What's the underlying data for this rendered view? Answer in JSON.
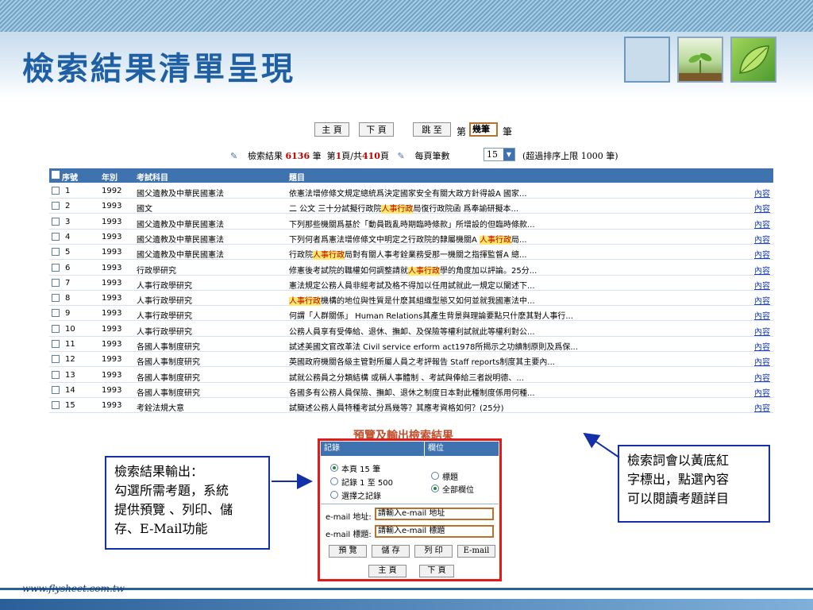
{
  "slide": {
    "title": "檢索結果清單呈現",
    "footer_url": "www.flysheet.com.tw"
  },
  "nav": {
    "home": "主 頁",
    "next": "下 頁",
    "jump": "跳 至",
    "page_prefix": "第",
    "page_value": "幾筆",
    "page_suffix": "筆"
  },
  "result_info": {
    "label": "檢索結果",
    "count": "6136",
    "count_unit": "筆",
    "page_text_prefix": "第",
    "page_current": "1",
    "page_text_mid": "頁/共",
    "page_total": "410",
    "page_text_suffix": "頁",
    "per_page_label": "每頁筆數",
    "per_page_value": "15",
    "limit_note": "(超過排序上限 1000 筆)"
  },
  "table": {
    "columns": [
      "序號",
      "年別",
      "考試科目",
      "題目"
    ],
    "rows": [
      {
        "no": "1",
        "year": "1992",
        "subject": "國父遺教及中華民國憲法",
        "pre": "依憲法增修條文規定總統爲決定國家安全有關大政方針得設A 國家...",
        "hl": "",
        "post": "",
        "link": "內容"
      },
      {
        "no": "2",
        "year": "1993",
        "subject": "國文",
        "pre": "二 公文 三十分試擬行政院",
        "hl": "人事行政",
        "post": "局復行政院函 爲奉諭研擬本...",
        "link": "內容"
      },
      {
        "no": "3",
        "year": "1993",
        "subject": "國父遺教及中華民國憲法",
        "pre": "下列那些機關爲基於「動員戡亂時期臨時條款」所增設的但臨時條款...",
        "hl": "",
        "post": "",
        "link": "內容"
      },
      {
        "no": "4",
        "year": "1993",
        "subject": "國父遺教及中華民國憲法",
        "pre": "下列何者爲憲法增修條文中明定之行政院的隸屬機關A ",
        "hl": "人事行政",
        "post": "局...",
        "link": "內容"
      },
      {
        "no": "5",
        "year": "1993",
        "subject": "國父遺教及中華民國憲法",
        "pre": "行政院",
        "hl": "人事行政",
        "post": "局對有關人事考銓業務受那一機關之指揮監督A 總...",
        "link": "內容"
      },
      {
        "no": "6",
        "year": "1993",
        "subject": "行政學研究",
        "pre": "修憲後考試院的職權如何調整請就",
        "hl": "人事行政",
        "post": "學的角度加以評論。25分...",
        "link": "內容"
      },
      {
        "no": "7",
        "year": "1993",
        "subject": "人事行政學研究",
        "pre": "憲法規定公務人員非經考試及格不得加以任用試就此一規定以闡述下...",
        "hl": "",
        "post": "",
        "link": "內容"
      },
      {
        "no": "8",
        "year": "1993",
        "subject": "人事行政學研究",
        "pre": "",
        "hl": "人事行政",
        "post": "機構的地位與性質是什麽其組織型態又如何並就我國憲法中...",
        "link": "內容"
      },
      {
        "no": "9",
        "year": "1993",
        "subject": "人事行政學研究",
        "pre": "何謂「人群關係」 Human Relations其產生背景與理論要點只什麽其對人事行...",
        "hl": "",
        "post": "",
        "link": "內容"
      },
      {
        "no": "10",
        "year": "1993",
        "subject": "人事行政學研究",
        "pre": "公務人員享有受俸給、退休、撫卹、及保險等權利試就此等權利對公...",
        "hl": "",
        "post": "",
        "link": "內容"
      },
      {
        "no": "11",
        "year": "1993",
        "subject": "各國人事制度研究",
        "pre": "試述美國文官改革法 Civil service erform act1978所揭示之功績制原則及爲保...",
        "hl": "",
        "post": "",
        "link": "內容"
      },
      {
        "no": "12",
        "year": "1993",
        "subject": "各國人事制度研究",
        "pre": "英國政府機關各級主管對所屬人員之考評報告 Staff reports制度其主要內...",
        "hl": "",
        "post": "",
        "link": "內容"
      },
      {
        "no": "13",
        "year": "1993",
        "subject": "各國人事制度研究",
        "pre": "試就公務員之分類結構 或稱人事體制 、考試與俸給三者說明德、...",
        "hl": "",
        "post": "",
        "link": "內容"
      },
      {
        "no": "14",
        "year": "1993",
        "subject": "各國人事制度研究",
        "pre": "各國多有公務人員保險、撫卹、退休之制度日本對此種制度係用何種...",
        "hl": "",
        "post": "",
        "link": "內容"
      },
      {
        "no": "15",
        "year": "1993",
        "subject": "考銓法規大意",
        "pre": "試簡述公務人員特種考試分爲幾等？其應考資格如何？(25分)",
        "hl": "",
        "post": "",
        "link": "內容"
      }
    ]
  },
  "output_panel": {
    "title": "預覽及輸出檢索結果",
    "col_records": "記錄",
    "col_fields": "欄位",
    "opt_page": "本頁 15 筆",
    "opt_range": "記錄 1 至 500",
    "opt_selected": "選擇之記錄",
    "opt_title": "標題",
    "opt_all": "全部欄位",
    "email_label": "e-mail 地址:",
    "email_value": "請輸入e-mail 地址",
    "subject_label": "e-mail 標題:",
    "subject_value": "請輸入e-mail 標題",
    "btn_preview": "預 覽",
    "btn_save": "儲 存",
    "btn_print": "列 印",
    "btn_email": "E-mail",
    "btn_home": "主 頁",
    "btn_next": "下 頁"
  },
  "callouts": {
    "left_line1": "檢索結果輸出：",
    "left_line2": "勾選所需考題，系統",
    "left_line3": "提供預覽 、列印、儲",
    "left_line4": "存、E-Mail功能",
    "right_line1": "檢索詞會以黃底紅",
    "right_line2": "字標出，點選內容",
    "right_line3": "可以閱讀考題詳目"
  },
  "colors": {
    "title_blue": "#1f5fa3",
    "header_blue": "#3f73b0",
    "highlight_bg": "#ffe86a",
    "highlight_fg": "#c00000",
    "panel_border": "#e11a1a",
    "callout_border": "#1430a8"
  }
}
